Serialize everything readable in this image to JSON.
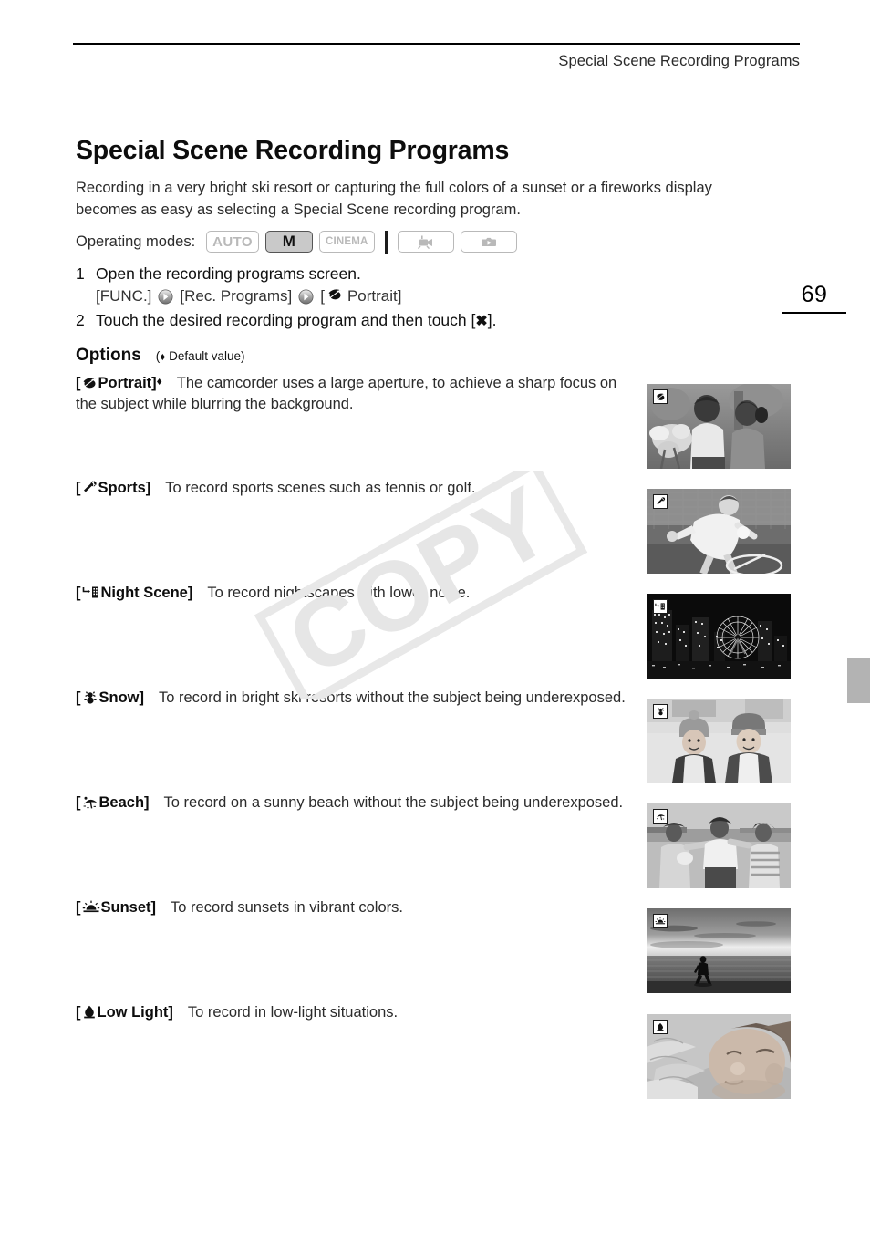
{
  "header": {
    "running_title": "Special Scene Recording Programs",
    "page_number": "69"
  },
  "watermark": {
    "text": "COPY"
  },
  "main": {
    "title": "Special Scene Recording Programs",
    "intro": "Recording in a very bright ski resort or capturing the full colors of a sunset or a fireworks display becomes as easy as selecting a Special Scene recording program.",
    "operating_modes": {
      "label": "Operating modes:",
      "badges": [
        {
          "label": "AUTO",
          "state": "inactive",
          "type": "text"
        },
        {
          "label": "M",
          "state": "active",
          "type": "text"
        },
        {
          "label": "CINEMA",
          "state": "inactive",
          "type": "text"
        },
        {
          "label": "movie-mode-icon",
          "state": "inactive",
          "type": "icon"
        },
        {
          "label": "photo-mode-icon",
          "state": "inactive",
          "type": "icon"
        }
      ]
    },
    "steps": [
      {
        "num": "1",
        "text": "Open the recording programs screen."
      },
      {
        "num": "2",
        "text": "Touch the desired recording program and then touch ["
      }
    ],
    "step1_path": {
      "part1": "[FUNC.]",
      "part2": "[Rec. Programs]",
      "part3_prefix": "[",
      "part3_label": "Portrait]"
    },
    "step2_suffix": "].",
    "options_header": {
      "label": "Options",
      "note_open": "(",
      "note_text": "Default value)"
    },
    "options": [
      {
        "icon": "portrait-icon",
        "name": "Portrait]",
        "open_bracket": "[",
        "default_marker": true,
        "description": "The camcorder uses a large aperture, to achieve a sharp focus on the subject while blurring the background."
      },
      {
        "icon": "sports-icon",
        "name": "Sports]",
        "open_bracket": "[",
        "default_marker": false,
        "description": "To record sports scenes such as tennis or golf."
      },
      {
        "icon": "night-scene-icon",
        "name": "Night Scene]",
        "open_bracket": "[",
        "default_marker": false,
        "description": "To record nightscapes with lower noise."
      },
      {
        "icon": "snow-icon",
        "name": "Snow]",
        "open_bracket": "[",
        "default_marker": false,
        "description": "To record in bright ski resorts without the subject being underexposed."
      },
      {
        "icon": "beach-icon",
        "name": "Beach]",
        "open_bracket": "[",
        "default_marker": false,
        "description": "To record on a sunny beach without the subject being underexposed."
      },
      {
        "icon": "sunset-icon",
        "name": "Sunset]",
        "open_bracket": "[",
        "default_marker": false,
        "description": "To record sunsets in vibrant colors."
      },
      {
        "icon": "low-light-icon",
        "name": "Low Light]",
        "open_bracket": "[",
        "default_marker": false,
        "description": "To record in low-light situations."
      }
    ],
    "thumbnails": [
      {
        "alt": "portrait-sample-photo",
        "badge": "portrait-icon"
      },
      {
        "alt": "sports-sample-photo",
        "badge": "sports-icon"
      },
      {
        "alt": "night-scene-sample-photo",
        "badge": "night-scene-icon"
      },
      {
        "alt": "snow-sample-photo",
        "badge": "snow-icon"
      },
      {
        "alt": "beach-sample-photo",
        "badge": "beach-icon"
      },
      {
        "alt": "sunset-sample-photo",
        "badge": "sunset-icon"
      },
      {
        "alt": "low-light-sample-photo",
        "badge": "low-light-icon"
      }
    ]
  },
  "colors": {
    "tab_gray": "#b3b3b3",
    "badge_inactive": "#b9b9b9",
    "badge_active_fill": "#c9c9c9",
    "watermark": "#e6e6e6"
  }
}
